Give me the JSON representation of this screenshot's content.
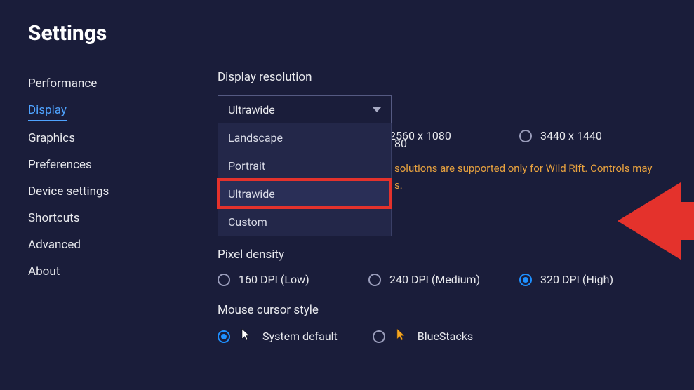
{
  "page_title": "Settings",
  "nav": {
    "items": [
      {
        "label": "Performance"
      },
      {
        "label": "Display",
        "active": true
      },
      {
        "label": "Graphics"
      },
      {
        "label": "Preferences"
      },
      {
        "label": "Device settings"
      },
      {
        "label": "Shortcuts"
      },
      {
        "label": "Advanced"
      },
      {
        "label": "About"
      }
    ]
  },
  "display_resolution": {
    "label": "Display resolution",
    "selected": "Ultrawide",
    "options": [
      "Landscape",
      "Portrait",
      "Ultrawide",
      "Custom"
    ],
    "resolutions": [
      "2560 x 1080",
      "3440 x 1440"
    ],
    "recommended_suffix": "80",
    "warning": "solutions are supported only for Wild Rift. Controls may",
    "warning_suffix": "s."
  },
  "pixel_density": {
    "label": "Pixel density",
    "options": [
      {
        "label": "160 DPI (Low)",
        "checked": false
      },
      {
        "label": "240 DPI (Medium)",
        "checked": false
      },
      {
        "label": "320 DPI (High)",
        "checked": true
      }
    ]
  },
  "mouse_cursor": {
    "label": "Mouse cursor style",
    "options": [
      {
        "label": "System default",
        "checked": true,
        "glyph": "white"
      },
      {
        "label": "BlueStacks",
        "checked": false,
        "glyph": "orange"
      }
    ]
  }
}
